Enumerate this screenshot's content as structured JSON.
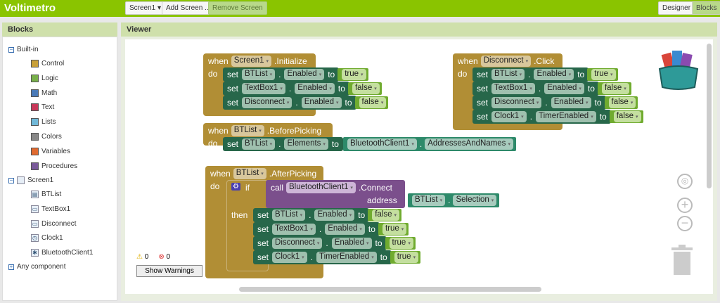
{
  "app": {
    "title": "Voltimetro"
  },
  "toolbar": {
    "screen": "Screen1 ▾",
    "add_screen": "Add Screen ...",
    "remove_screen": "Remove Screen",
    "designer": "Designer",
    "blocks": "Blocks"
  },
  "blocks_panel": {
    "title": "Blocks",
    "builtin": "Built-in",
    "builtin_items": [
      {
        "label": "Control",
        "color": "#c8a038"
      },
      {
        "label": "Logic",
        "color": "#78b04a"
      },
      {
        "label": "Math",
        "color": "#4a7ab8"
      },
      {
        "label": "Text",
        "color": "#c8385a"
      },
      {
        "label": "Lists",
        "color": "#70b8d8"
      },
      {
        "label": "Colors",
        "color": "#888888"
      },
      {
        "label": "Variables",
        "color": "#e06a30"
      },
      {
        "label": "Procedures",
        "color": "#7a5a9a"
      }
    ],
    "screen": "Screen1",
    "components": [
      "BTList",
      "TextBox1",
      "Disconnect",
      "Clock1",
      "BluetoothClient1"
    ],
    "any": "Any component"
  },
  "viewer": {
    "title": "Viewer"
  },
  "warnings": {
    "warn_count": "0",
    "error_count": "0",
    "show_label": "Show Warnings"
  },
  "events": [
    {
      "when": "when",
      "component": "Screen1",
      "event": ".Initialize",
      "do": "do",
      "statements": [
        [
          "BTList",
          "Enabled",
          "true"
        ],
        [
          "TextBox1",
          "Enabled",
          "false"
        ],
        [
          "Disconnect",
          "Enabled",
          "false"
        ]
      ]
    },
    {
      "when": "when",
      "component": "BTList",
      "event": ".BeforePicking",
      "do": "do",
      "statements": [
        [
          "BTList",
          "Elements",
          "BluetoothClient1",
          "AddressesAndNames"
        ]
      ]
    },
    {
      "when": "when",
      "component": "BTList",
      "event": ".AfterPicking",
      "do": "do",
      "if": "if",
      "then": "then",
      "call": "call",
      "call_component": "BluetoothClient1",
      "call_method": ".Connect",
      "address_label": "address",
      "address_component": "BTList",
      "address_prop": "Selection",
      "statements": [
        [
          "BTList",
          "Enabled",
          "false"
        ],
        [
          "TextBox1",
          "Enabled",
          "true"
        ],
        [
          "Disconnect",
          "Enabled",
          "true"
        ],
        [
          "Clock1",
          "TimerEnabled",
          "true"
        ]
      ]
    },
    {
      "when": "when",
      "component": "Disconnect",
      "event": ".Click",
      "do": "do",
      "statements": [
        [
          "BTList",
          "Enabled",
          "true"
        ],
        [
          "TextBox1",
          "Enabled",
          "false"
        ],
        [
          "Disconnect",
          "Enabled",
          "false"
        ],
        [
          "Clock1",
          "TimerEnabled",
          "false"
        ]
      ]
    }
  ],
  "words": {
    "set": "set",
    "to": "to",
    "dot": "."
  }
}
